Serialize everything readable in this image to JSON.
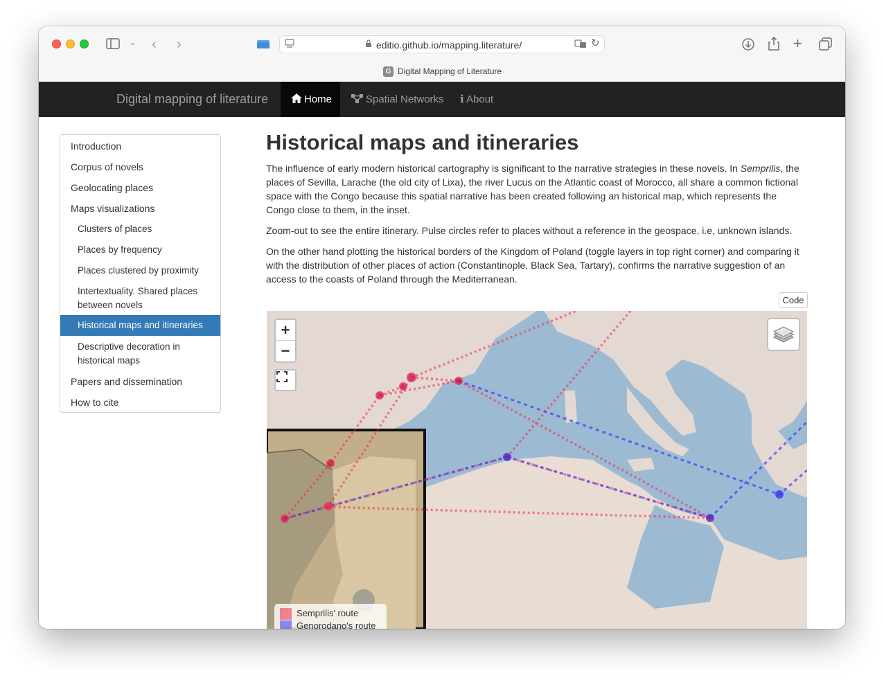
{
  "browser": {
    "url": "editio.github.io/mapping.literature/",
    "tab_title": "Digital Mapping of Literature",
    "favicon_letter": "G"
  },
  "navbar": {
    "brand": "Digital mapping of literature",
    "items": [
      {
        "label": "Home",
        "icon": "home-icon",
        "active": true
      },
      {
        "label": "Spatial Networks",
        "icon": "network-icon",
        "active": false
      },
      {
        "label": "About",
        "icon": "info-icon",
        "active": false
      }
    ]
  },
  "toc": {
    "items": [
      {
        "label": "Introduction",
        "level": 1
      },
      {
        "label": "Corpus of novels",
        "level": 1
      },
      {
        "label": "Geolocating places",
        "level": 1
      },
      {
        "label": "Maps visualizations",
        "level": 1
      },
      {
        "label": "Clusters of places",
        "level": 2
      },
      {
        "label": "Places by frequency",
        "level": 2
      },
      {
        "label": "Places clustered by proximity",
        "level": 2
      },
      {
        "label": "Intertextuality. Shared places between novels",
        "level": 2
      },
      {
        "label": "Historical maps and itineraries",
        "level": 2,
        "active": true
      },
      {
        "label": "Descriptive decoration in historical maps",
        "level": 2
      },
      {
        "label": "Papers and dissemination",
        "level": 1
      },
      {
        "label": "How to cite",
        "level": 1
      }
    ]
  },
  "main": {
    "title": "Historical maps and itineraries",
    "para1_a": "The influence of early modern historical cartography is significant to the narrative strategies in these novels. In ",
    "para1_em": "Semprilis",
    "para1_b": ", the places of Sevilla, Larache (the old city of Lixa), the river Lucus on the Atlantic coast of Morocco, all share a common fictional space with the Congo because this spatial narrative has been created following an historical map, which represents the Congo close to them, in the inset.",
    "para2": "Zoom-out to see the entire itinerary. Pulse circles refer to places without a reference in the geospace, i.e, unknown islands.",
    "para3": "On the other hand plotting the historical borders of the Kingdom of Poland (toggle layers in top right corner) and comparing it with the distribution of other places of action (Constantinople, Black Sea, Tartary), confirms the narrative suggestion of an access to the coasts of Poland through the Mediterranean.",
    "code_button": "Code"
  },
  "map": {
    "zoom_in": "+",
    "zoom_out": "−",
    "legend": [
      {
        "label": "Semprilis' route",
        "color": "#f0284a"
      },
      {
        "label": "Genorodano's route",
        "color": "#3333ff"
      }
    ],
    "colors": {
      "sea": "#9dbad3",
      "land": "#e4d8d2",
      "route_red": "#f0284a",
      "route_blue": "#3333ff",
      "marker": "#c8165a"
    }
  }
}
